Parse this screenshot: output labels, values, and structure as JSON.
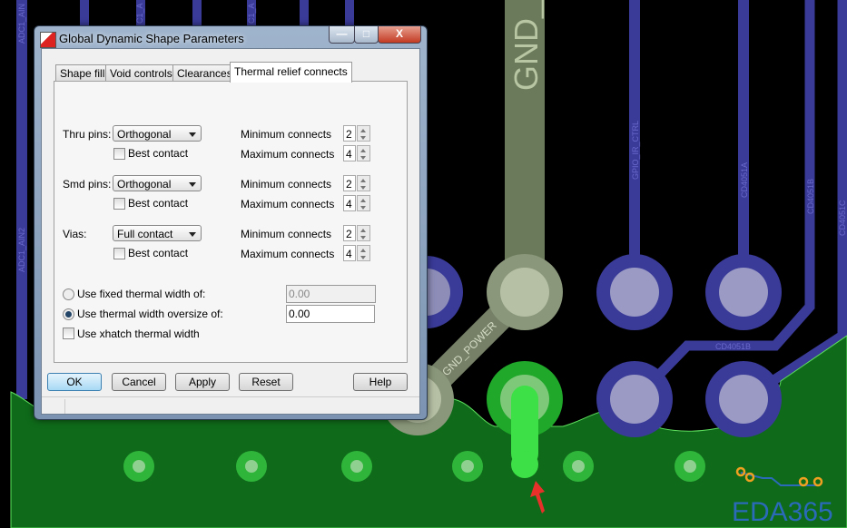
{
  "pcb": {
    "net_labels": [
      "ADC1_AIN",
      "C1_A",
      "C1_A",
      "ADC1_AIN2",
      "GND_",
      "GND_POWER",
      "GPIO_IR_CTRL",
      "CD4051A",
      "CD4051B",
      "CD4051C",
      "CD4051B"
    ],
    "colors": {
      "background": "#000000",
      "trace": "#3a3a99",
      "gnd": "#6b7a5a",
      "fill": "#0f6b1a",
      "via": "#34c23e",
      "arrow": "#e8302a"
    },
    "watermark": "EDA365"
  },
  "dialog": {
    "title": "Global Dynamic Shape Parameters",
    "tabs": [
      {
        "label": "Shape fill",
        "active": false
      },
      {
        "label": "Void controls",
        "active": false
      },
      {
        "label": "Clearances",
        "active": false
      },
      {
        "label": "Thermal relief connects",
        "active": true
      }
    ],
    "groups": [
      {
        "label": "Thru pins:",
        "value": "Orthogonal",
        "best_contact": "Best contact",
        "best_checked": false,
        "min_label": "Minimum connects",
        "min": "2",
        "max_label": "Maximum connects",
        "max": "4"
      },
      {
        "label": "Smd pins:",
        "value": "Orthogonal",
        "best_contact": "Best contact",
        "best_checked": false,
        "min_label": "Minimum connects",
        "min": "2",
        "max_label": "Maximum connects",
        "max": "4"
      },
      {
        "label": "Vias:",
        "value": "Full contact",
        "best_contact": "Best contact",
        "best_checked": false,
        "min_label": "Minimum connects",
        "min": "2",
        "max_label": "Maximum connects",
        "max": "4"
      }
    ],
    "fixed_width": {
      "label": "Use fixed thermal width of:",
      "value": "0.00",
      "selected": false
    },
    "oversize_width": {
      "label": "Use thermal width oversize of:",
      "value": "0.00",
      "selected": true
    },
    "xhatch": {
      "label": "Use xhatch thermal width",
      "checked": false
    },
    "buttons": {
      "ok": "OK",
      "cancel": "Cancel",
      "apply": "Apply",
      "reset": "Reset",
      "help": "Help"
    }
  }
}
